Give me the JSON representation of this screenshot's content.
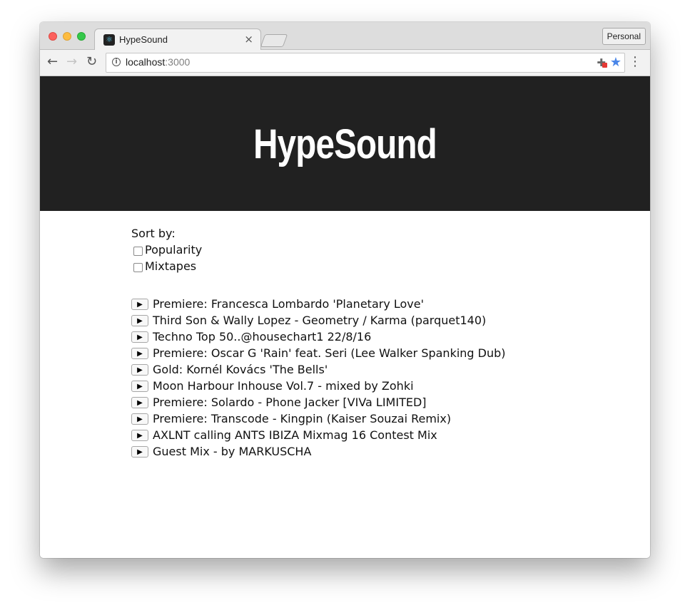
{
  "browser": {
    "tab_title": "HypeSound",
    "profile_label": "Personal",
    "url_host": "localhost",
    "url_port": ":3000"
  },
  "site": {
    "title": "HypeSound"
  },
  "sort": {
    "label": "Sort by:",
    "options": [
      {
        "label": "Popularity",
        "checked": false
      },
      {
        "label": "Mixtapes",
        "checked": false
      }
    ]
  },
  "tracks": [
    {
      "title": "Premiere: Francesca Lombardo 'Planetary Love'"
    },
    {
      "title": "Third Son & Wally Lopez - Geometry / Karma (parquet140)"
    },
    {
      "title": "Techno Top 50..@housechart1 22/8/16"
    },
    {
      "title": "Premiere: Oscar G 'Rain' feat. Seri (Lee Walker Spanking Dub)"
    },
    {
      "title": "Gold: Kornél Kovács 'The Bells'"
    },
    {
      "title": "Moon Harbour Inhouse Vol.7 - mixed by Zohki"
    },
    {
      "title": "Premiere: Solardo - Phone Jacker [VIVa LIMITED]"
    },
    {
      "title": "Premiere: Transcode - Kingpin (Kaiser Souzai Remix)"
    },
    {
      "title": "AXLNT calling ANTS IBIZA Mixmag 16 Contest Mix"
    },
    {
      "title": "Guest Mix - by MARKUSCHA"
    }
  ],
  "play_glyph": "▶"
}
